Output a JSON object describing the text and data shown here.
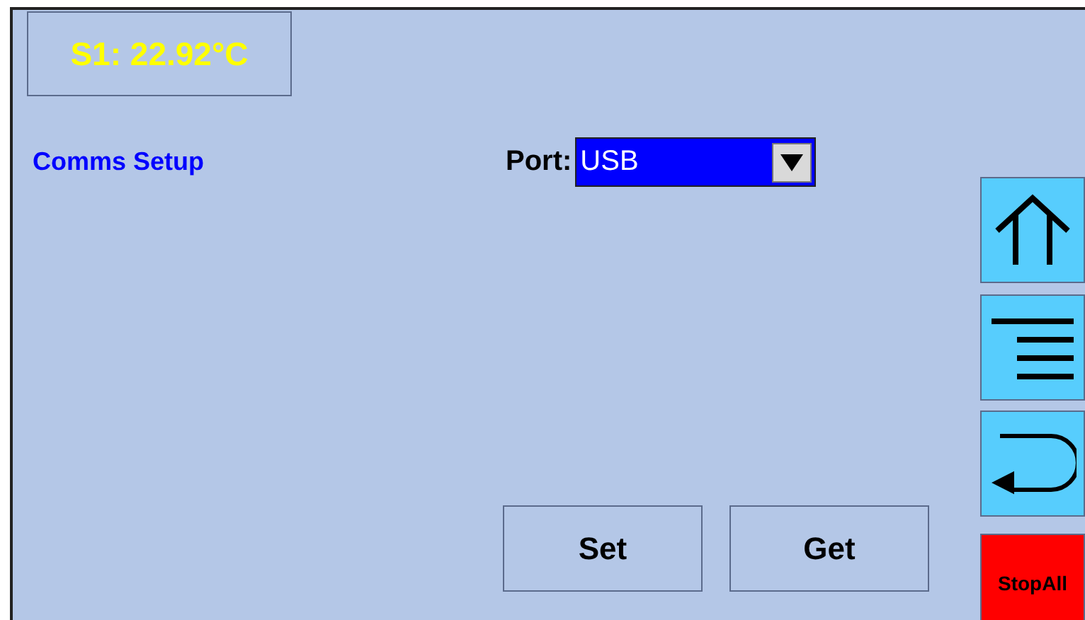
{
  "sensor_readout": "S1: 22.92°C",
  "section_title": "Comms Setup",
  "port": {
    "label": "Port:",
    "value": "USB"
  },
  "buttons": [
    "Set",
    "Get"
  ],
  "side_buttons": [
    {
      "kind": "up"
    },
    {
      "kind": "menu"
    },
    {
      "kind": "back"
    },
    {
      "kind": "stop",
      "label": "StopAll"
    }
  ]
}
